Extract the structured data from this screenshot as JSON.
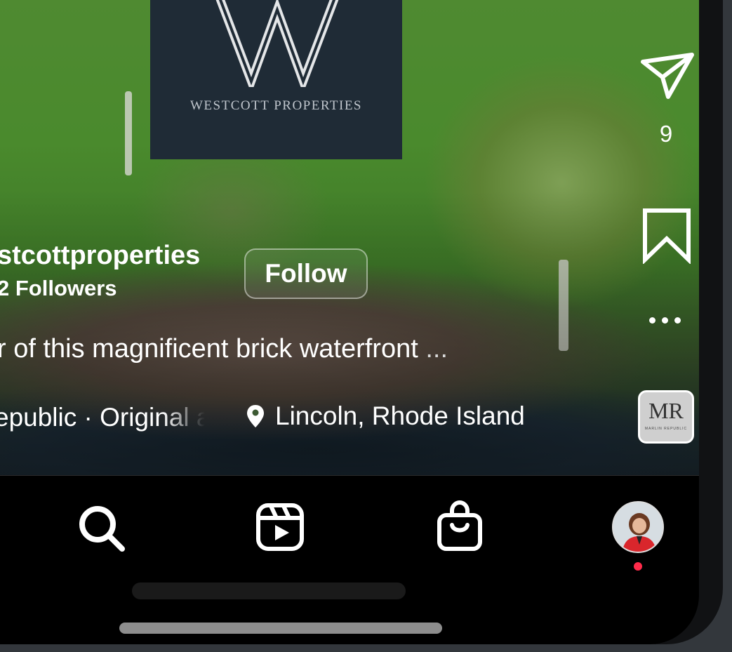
{
  "reel": {
    "brand_card_text": "WESTCOTT PROPERTIES",
    "account_name": "stcottproperties",
    "followers": "2 Followers",
    "follow_label": "Follow",
    "caption": "r of this magnificent brick waterfront",
    "caption_more": " ...",
    "audio": "epublic · Original audio",
    "location": "Lincoln, Rhode Island"
  },
  "side_actions": {
    "share_count": "9",
    "audio_thumb_text": "MR",
    "audio_thumb_subtext": "MARLIN REPUBLIC"
  },
  "bottom_nav": {
    "items": [
      "search",
      "reels",
      "shop",
      "profile"
    ],
    "profile_has_notification": true
  },
  "colors": {
    "notification_dot": "#ff2b4a",
    "brand_card_bg": "#1f2b36"
  }
}
